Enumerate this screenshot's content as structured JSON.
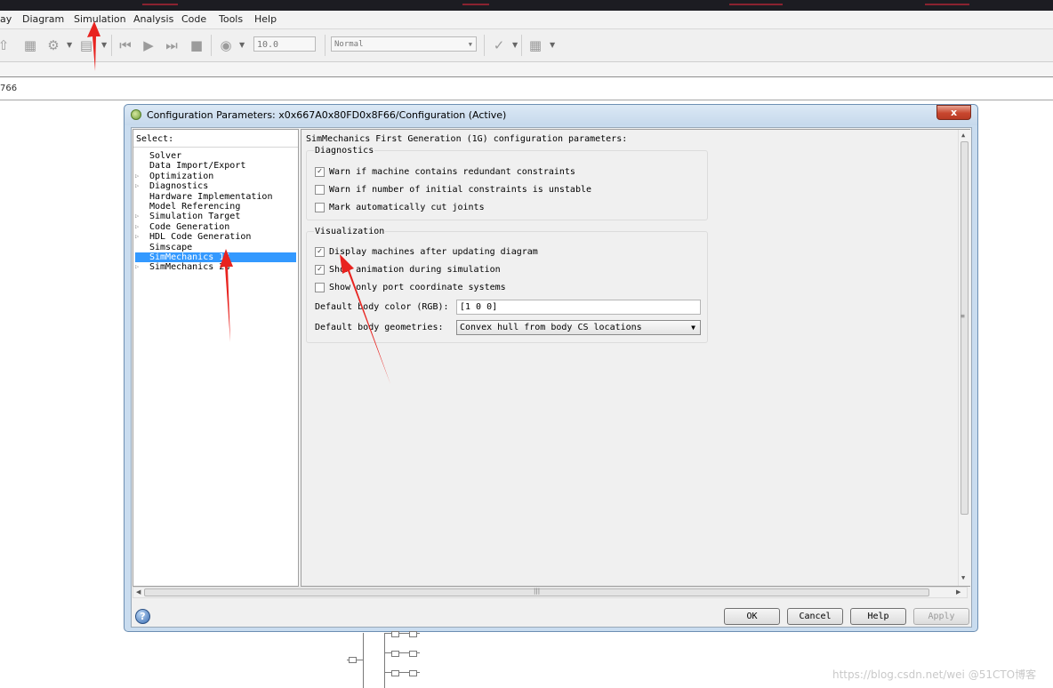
{
  "menubar": {
    "items": [
      "ay",
      "Diagram",
      "Simulation",
      "Analysis",
      "Code",
      "Tools",
      "Help"
    ]
  },
  "toolbar": {
    "stop_time": "10.0",
    "sim_mode": "Normal"
  },
  "breadcrumb": "766",
  "dialog": {
    "title": "Configuration Parameters: x0x667A0x80FD0x8F66/Configuration (Active)",
    "close_label": "x",
    "tree": {
      "header": "Select:",
      "items": [
        {
          "label": "Solver",
          "expandable": false,
          "selected": false
        },
        {
          "label": "Data Import/Export",
          "expandable": false,
          "selected": false
        },
        {
          "label": "Optimization",
          "expandable": true,
          "selected": false
        },
        {
          "label": "Diagnostics",
          "expandable": true,
          "selected": false
        },
        {
          "label": "Hardware Implementation",
          "expandable": false,
          "selected": false
        },
        {
          "label": "Model Referencing",
          "expandable": false,
          "selected": false
        },
        {
          "label": "Simulation Target",
          "expandable": true,
          "selected": false
        },
        {
          "label": "Code Generation",
          "expandable": true,
          "selected": false
        },
        {
          "label": "HDL Code Generation",
          "expandable": true,
          "selected": false
        },
        {
          "label": "Simscape",
          "expandable": false,
          "selected": false
        },
        {
          "label": "SimMechanics 1G",
          "expandable": false,
          "selected": true
        },
        {
          "label": "SimMechanics 2G",
          "expandable": true,
          "selected": false
        }
      ]
    },
    "panel": {
      "header": "SimMechanics First Generation (1G) configuration parameters:",
      "diagnostics": {
        "title": "Diagnostics",
        "options": [
          {
            "label": "Warn if machine contains redundant constraints",
            "checked": true
          },
          {
            "label": "Warn if number of initial constraints is unstable",
            "checked": false
          },
          {
            "label": "Mark automatically cut joints",
            "checked": false
          }
        ]
      },
      "visualization": {
        "title": "Visualization",
        "options": [
          {
            "label": "Display machines after updating diagram",
            "checked": true
          },
          {
            "label": "Show animation during simulation",
            "checked": true
          },
          {
            "label": "Show only port coordinate systems",
            "checked": false
          }
        ],
        "body_color_label": "Default body color (RGB):",
        "body_color_value": "[1 0 0]",
        "body_geometries_label": "Default body geometries:",
        "body_geometries_value": "Convex hull from body CS locations"
      }
    },
    "buttons": {
      "ok": "OK",
      "cancel": "Cancel",
      "help": "Help",
      "apply": "Apply"
    }
  },
  "watermark": "https://blog.csdn.net/wei @51CTO博客",
  "colors": {
    "selection": "#3399ff",
    "annotation_arrow": "#e8231f",
    "dialog_frame": "#c9dcef"
  }
}
